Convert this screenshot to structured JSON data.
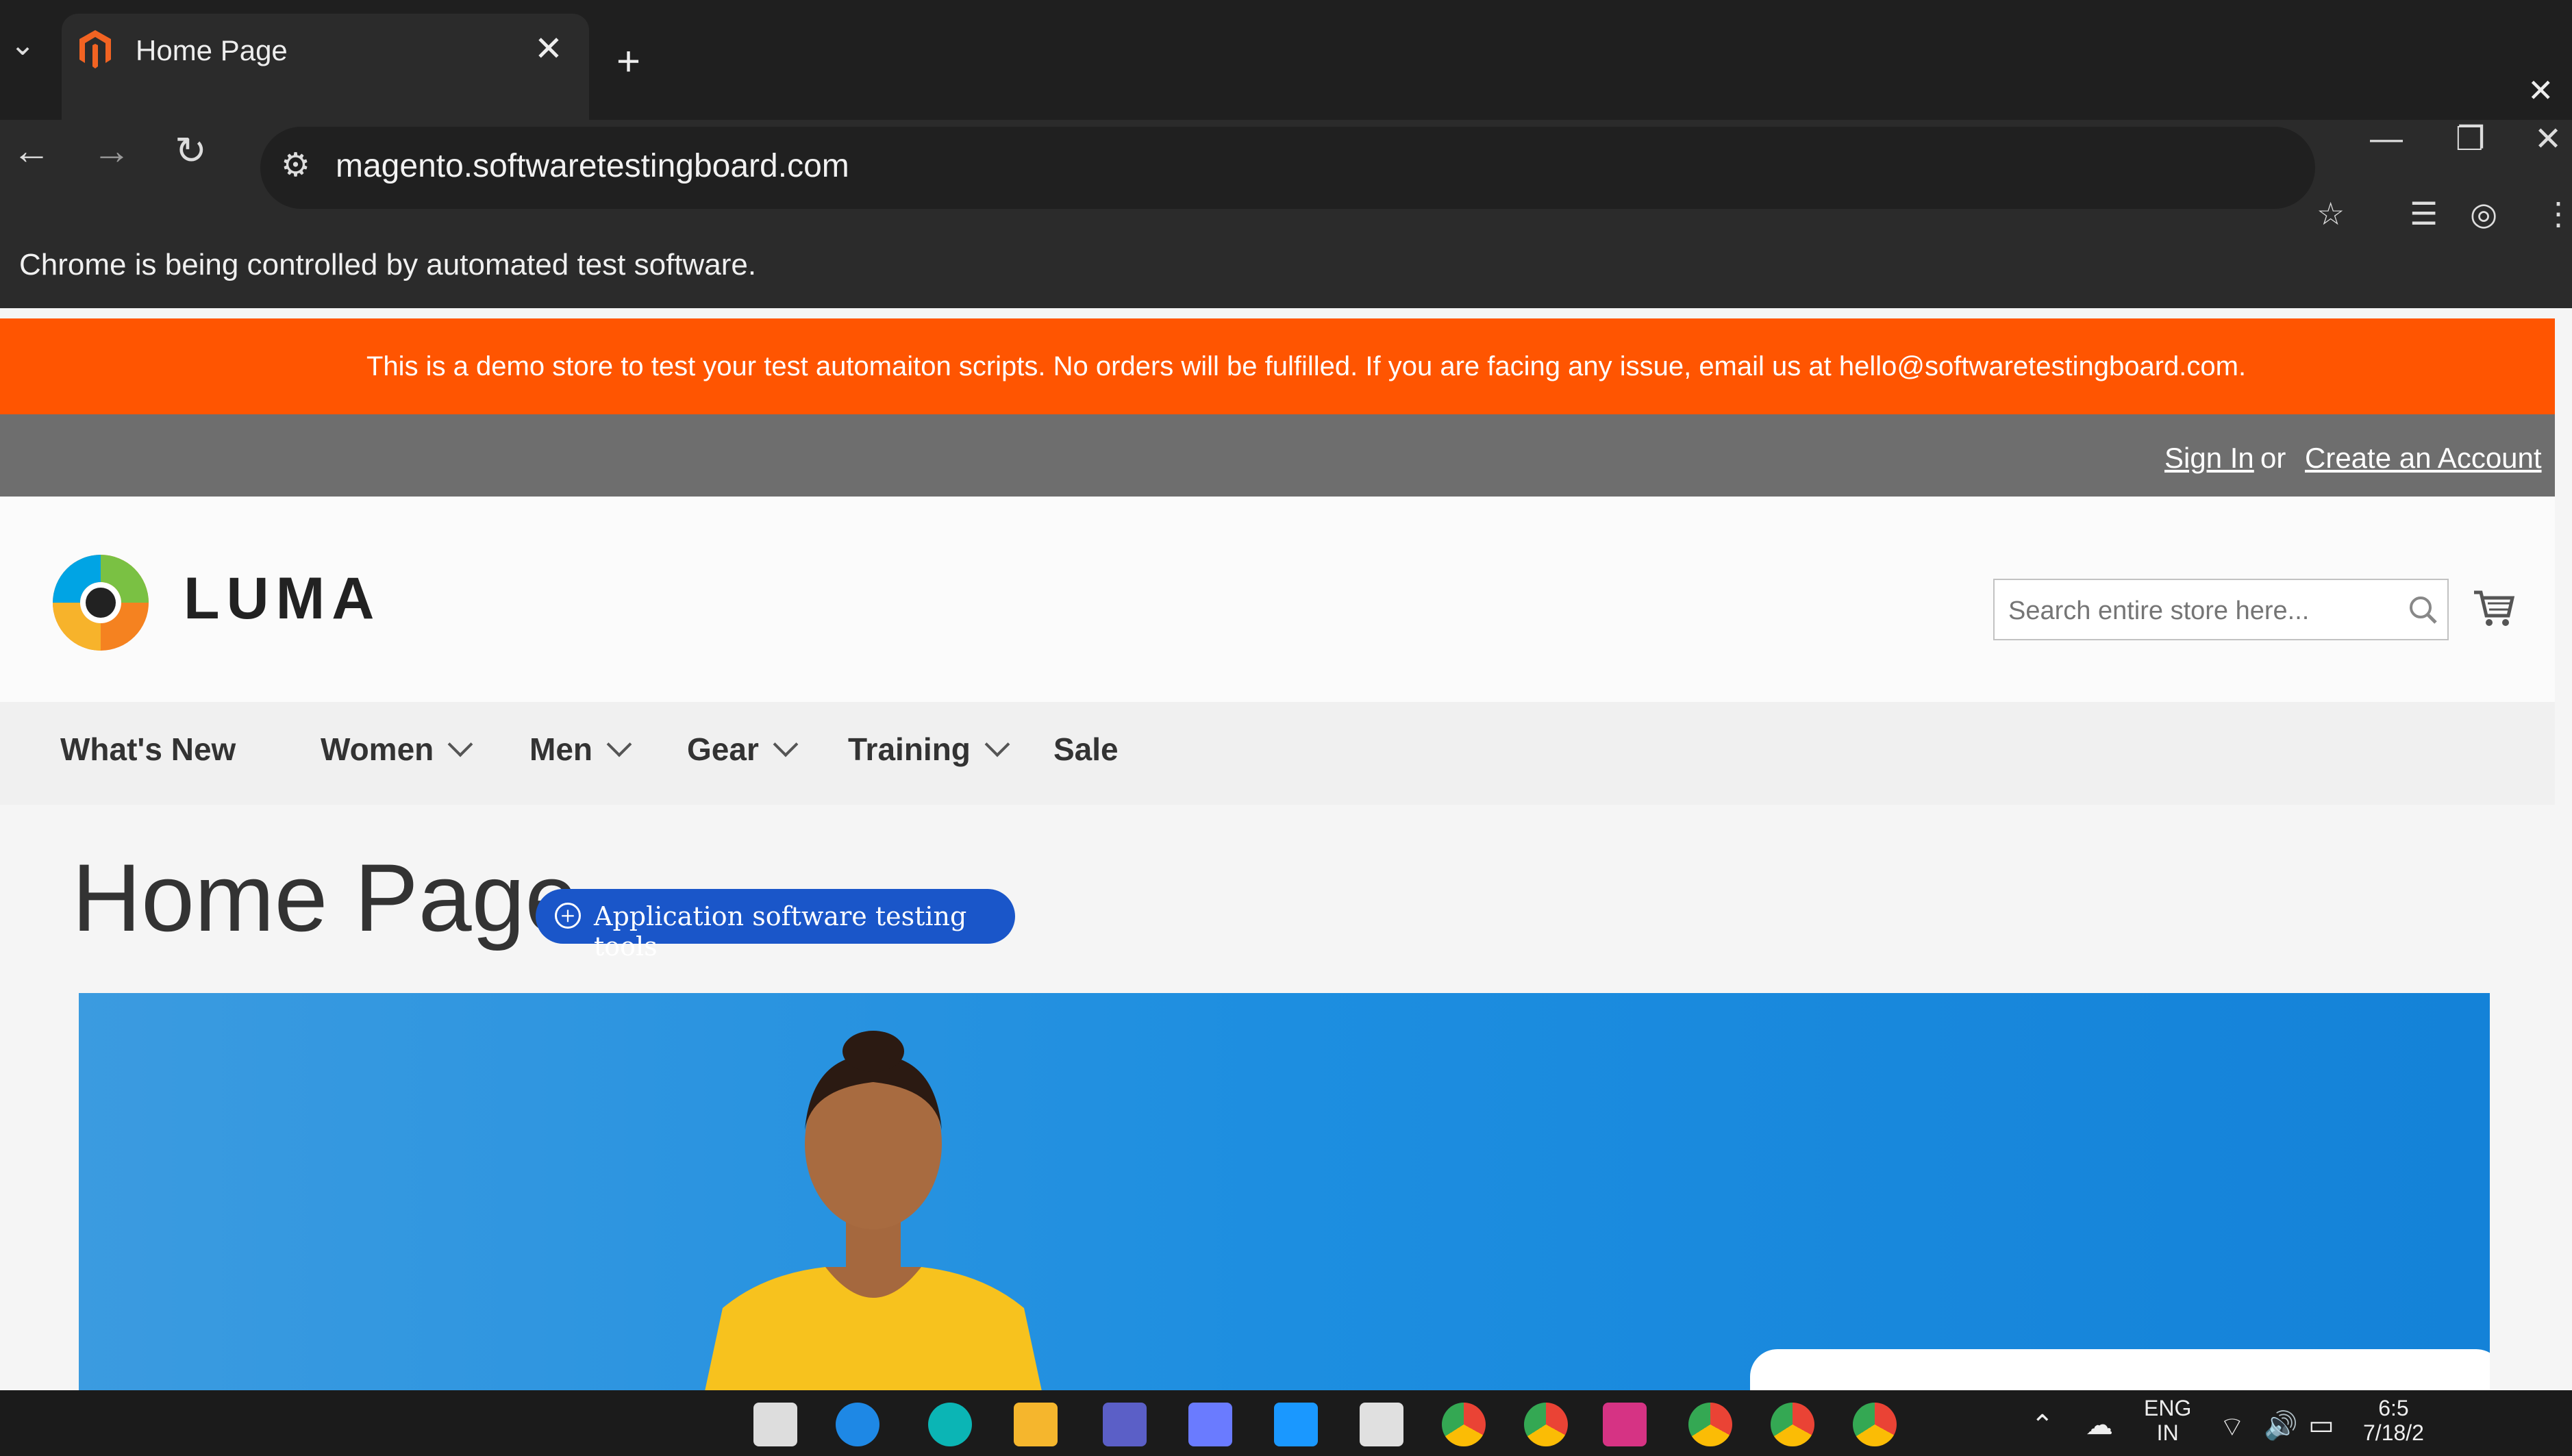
{
  "browser": {
    "tab_title": "Home Page",
    "new_tab_label": "+",
    "tab_close": "✕",
    "url": "magento.softwaretestingboard.com",
    "back": "←",
    "forward": "→",
    "reload": "↻",
    "minimize": "—",
    "restore": "❐",
    "close": "✕",
    "bookmark_star": "☆",
    "tab_search": "☰",
    "profile": "◎",
    "menu": "⋮",
    "infobar_text": "Chrome is being controlled by automated test software.",
    "infobar_close": "✕"
  },
  "store": {
    "demo_notice": "This is a demo store to test your test automaiton scripts. No orders will be fulfilled. If you are facing any issue, email us at hello@softwaretestingboard.com.",
    "sign_in": "Sign In",
    "or": "or",
    "create_account": "Create an Account",
    "logo_text": "LUMA",
    "search_placeholder": "Search entire store here...",
    "nav": [
      {
        "label": "What's New"
      },
      {
        "label": "Women"
      },
      {
        "label": "Men"
      },
      {
        "label": "Gear"
      },
      {
        "label": "Training"
      },
      {
        "label": "Sale"
      }
    ],
    "page_title": "Home Page",
    "bookmark_tooltip": "Application software testing tools",
    "accent": "#ff5501",
    "nav_text_color": "#333333"
  },
  "taskbar": {
    "lang_top": "ENG",
    "lang_bottom": "IN",
    "time": "6:5",
    "date": "7/18/2"
  }
}
